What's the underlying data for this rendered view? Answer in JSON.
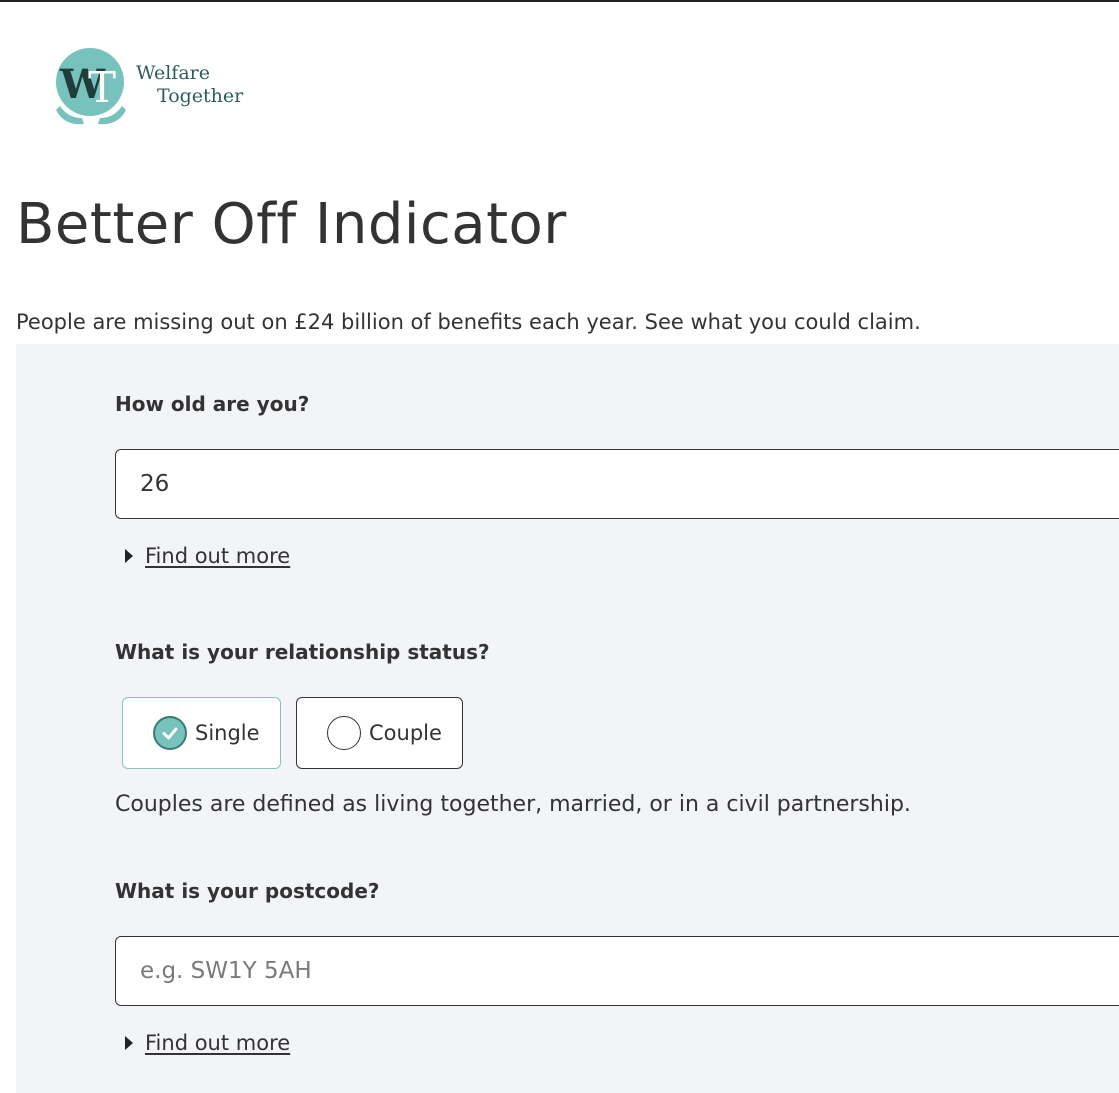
{
  "brand": {
    "logo_line1": "Welfare",
    "logo_line2": "Together",
    "accent_color": "#77c2bc",
    "text_color": "#2e5e58"
  },
  "page": {
    "title": "Better Off Indicator",
    "intro": "People are missing out on £24 billion of benefits each year. See what you could claim."
  },
  "age": {
    "label": "How old are you?",
    "value": "26",
    "find_out_more": "Find out more"
  },
  "relationship": {
    "label": "What is your relationship status?",
    "options": [
      {
        "label": "Single",
        "selected": true
      },
      {
        "label": "Couple",
        "selected": false
      }
    ],
    "helper": "Couples are defined as living together, married, or in a civil partnership."
  },
  "postcode": {
    "label": "What is your postcode?",
    "value": "",
    "placeholder": "e.g. SW1Y 5AH",
    "find_out_more": "Find out more"
  },
  "icons": {
    "caret": "caret-right-icon",
    "check": "check-icon"
  }
}
